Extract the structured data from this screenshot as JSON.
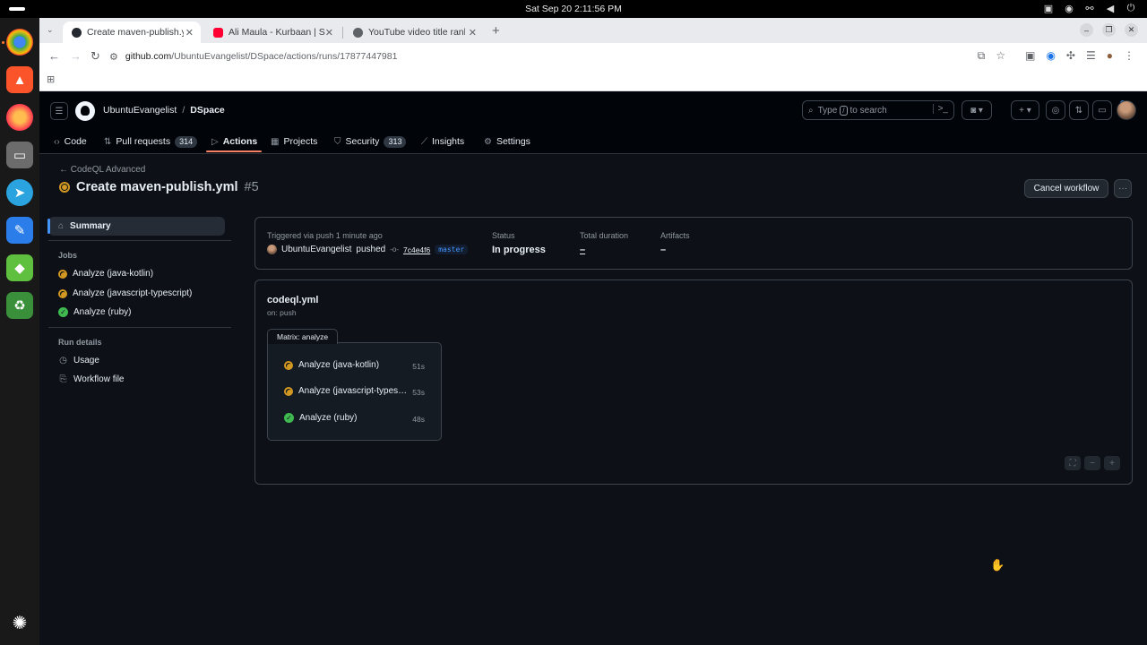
{
  "os": {
    "clock": "Sat Sep 20   2:11:56 PM",
    "tray_icons": [
      "camera-icon",
      "chrome-icon",
      "network-icon",
      "volume-icon",
      "power-icon"
    ]
  },
  "dock": {
    "apps": [
      "chrome",
      "brave",
      "firefox",
      "files",
      "telegram",
      "text-editor",
      "game",
      "trash",
      "ubuntu"
    ]
  },
  "browser": {
    "tabs": [
      {
        "title": "Create maven-publish.ym",
        "active": true
      },
      {
        "title": "Ali Maula - Kurbaan | Sal",
        "active": false
      },
      {
        "title": "YouTube video title rank",
        "active": false
      }
    ],
    "url_host": "github.com",
    "url_path": "/UbuntuEvangelist/DSpace/actions/runs/17877447981"
  },
  "github": {
    "owner": "UbuntuEvangelist",
    "repo": "DSpace",
    "search_placeholder": "Type",
    "search_kbd": "/",
    "search_suffix": "to search",
    "nav": [
      {
        "label": "Code",
        "icon": "code-icon"
      },
      {
        "label": "Pull requests",
        "count": "314",
        "icon": "pull-request-icon"
      },
      {
        "label": "Actions",
        "icon": "play-icon",
        "active": true
      },
      {
        "label": "Projects",
        "icon": "table-icon"
      },
      {
        "label": "Security",
        "count": "313",
        "icon": "shield-icon"
      },
      {
        "label": "Insights",
        "icon": "graph-icon"
      },
      {
        "label": "Settings",
        "icon": "gear-icon"
      }
    ]
  },
  "run": {
    "back_label": "CodeQL Advanced",
    "title": "Create maven-publish.yml",
    "number": "#5",
    "cancel_label": "Cancel workflow",
    "more_label": "···"
  },
  "sidebar": {
    "summary_label": "Summary",
    "jobs_heading": "Jobs",
    "jobs": [
      {
        "label": "Analyze (java-kotlin)",
        "status": "in_progress"
      },
      {
        "label": "Analyze (javascript-typescript)",
        "status": "in_progress"
      },
      {
        "label": "Analyze (ruby)",
        "status": "success"
      }
    ],
    "run_details_heading": "Run details",
    "usage_label": "Usage",
    "workflow_file_label": "Workflow file"
  },
  "summary": {
    "triggered_label": "Triggered via push 1 minute ago",
    "actor": "UbuntuEvangelist",
    "action": "pushed",
    "commit": "7c4e4f6",
    "branch": "master",
    "status_label": "Status",
    "status_value": "In progress",
    "duration_label": "Total duration",
    "duration_value": "–",
    "artifacts_label": "Artifacts",
    "artifacts_value": "–"
  },
  "graph": {
    "workflow_file": "codeql.yml",
    "trigger": "on: push",
    "matrix_label": "Matrix: analyze",
    "jobs": [
      {
        "label": "Analyze (java-kotlin)",
        "duration": "51s",
        "status": "in_progress"
      },
      {
        "label": "Analyze (javascript-typescript)",
        "duration": "53s",
        "status": "in_progress"
      },
      {
        "label": "Analyze (ruby)",
        "duration": "48s",
        "status": "success"
      }
    ]
  },
  "colors": {
    "in_progress": "#d29922",
    "success": "#3fb950",
    "accent_underline": "#f78166",
    "link_blue": "#4493f8"
  }
}
